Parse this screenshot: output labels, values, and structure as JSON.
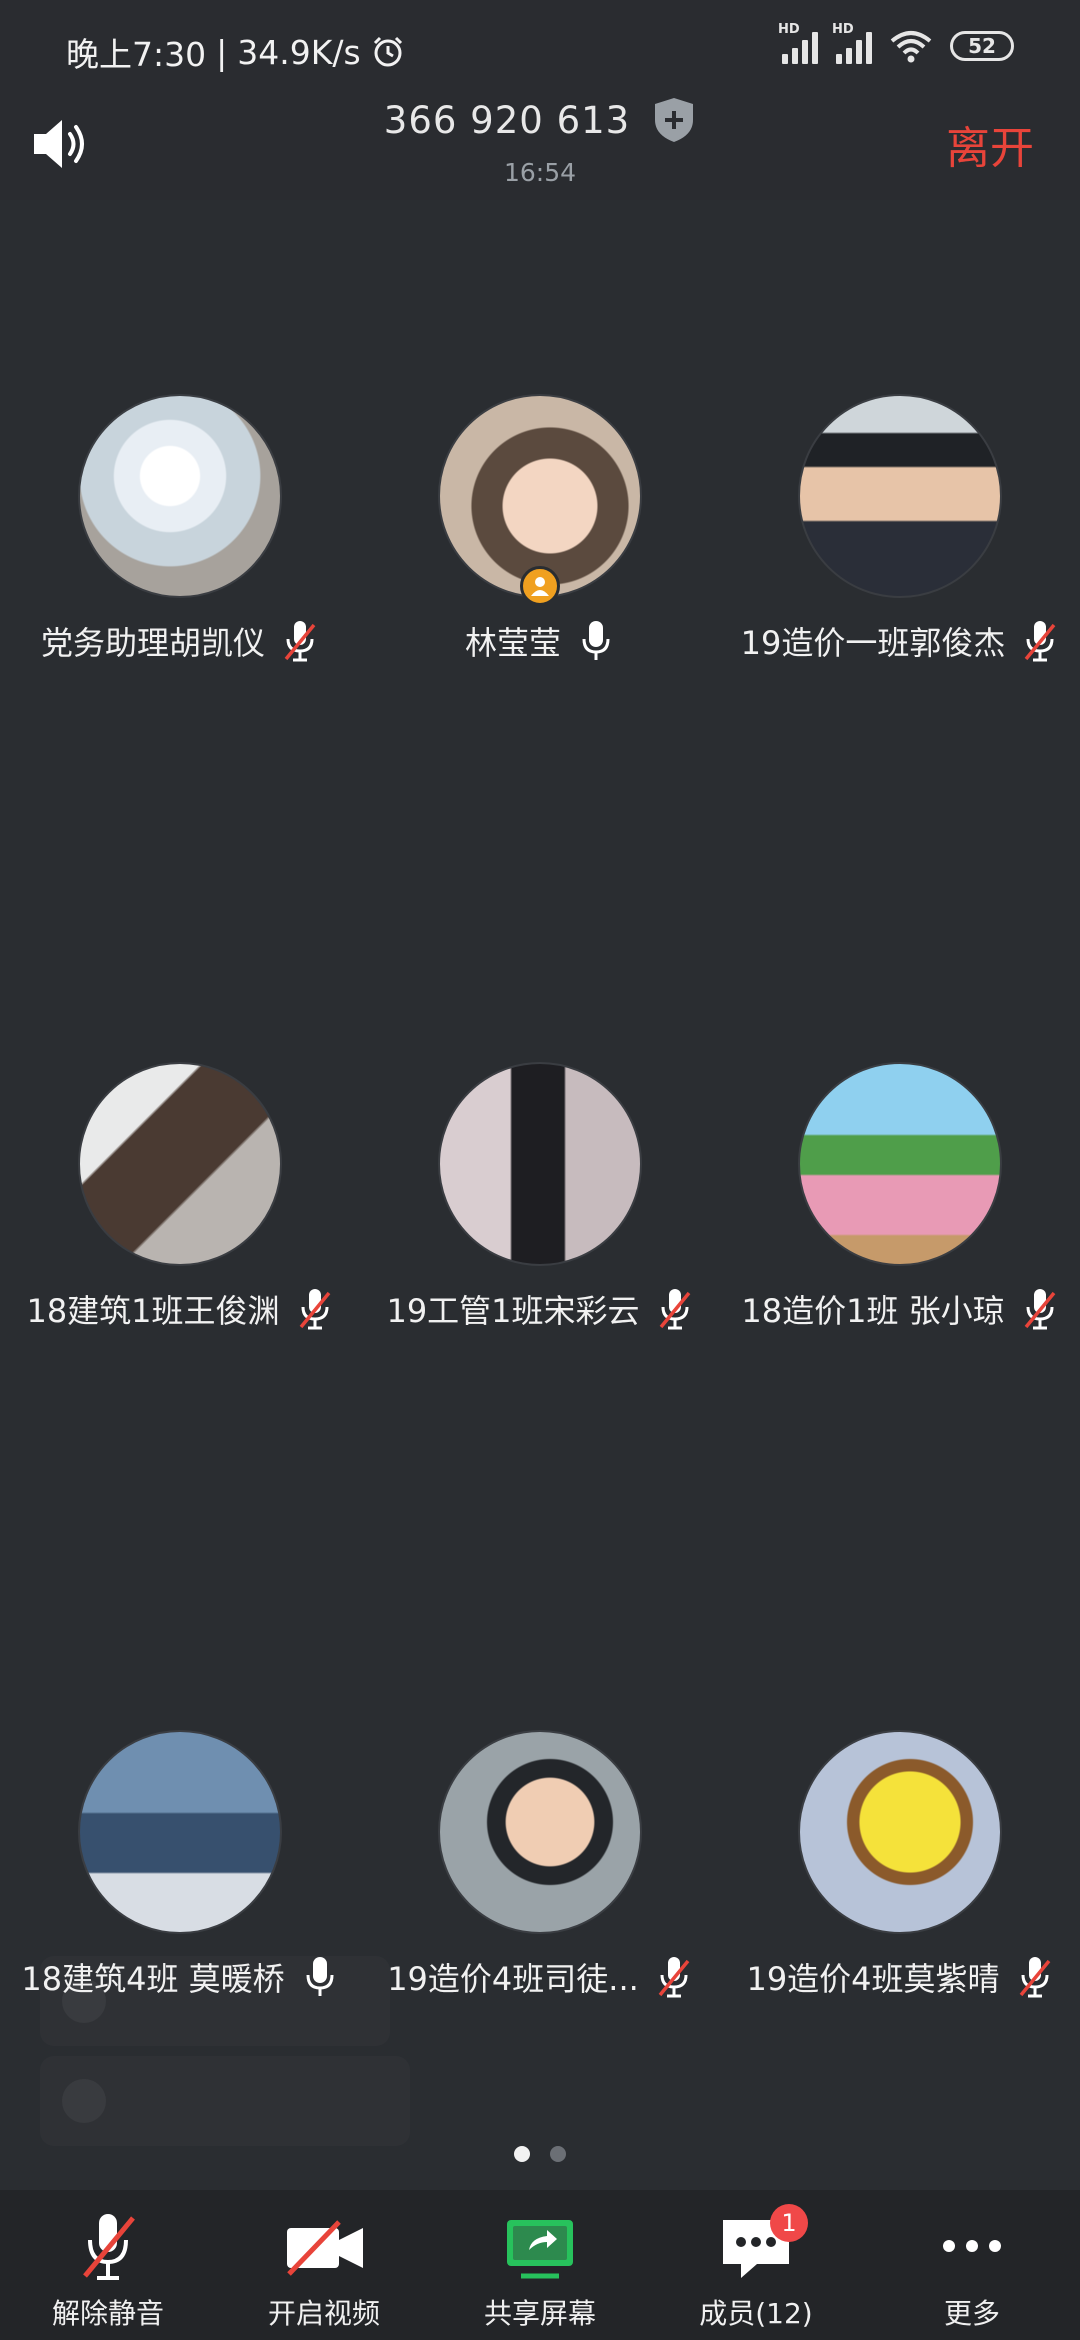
{
  "status_bar": {
    "time": "晚上7:30",
    "speed": "34.9K/s",
    "battery": "52",
    "icons": [
      "alarm-icon",
      "hd-signal-icon",
      "hd-signal-icon",
      "wifi-icon",
      "battery-icon"
    ]
  },
  "header": {
    "meeting_id": "366 920 613",
    "duration": "16:54",
    "leave_label": "离开"
  },
  "participants": [
    {
      "name": "党务助理胡凯仪",
      "mic": "muted",
      "host": false
    },
    {
      "name": "林莹莹",
      "mic": "on",
      "host": true
    },
    {
      "name": "19造价一班郭俊杰",
      "mic": "muted",
      "host": false
    },
    {
      "name": "18建筑1班王俊渊",
      "mic": "muted",
      "host": false
    },
    {
      "name": "19工管1班宋彩云",
      "mic": "muted",
      "host": false
    },
    {
      "name": "18造价1班  张小琼",
      "mic": "muted",
      "host": false
    },
    {
      "name": "18建筑4班 莫暖桥",
      "mic": "on",
      "host": false
    },
    {
      "name": "19造价4班司徒...",
      "mic": "muted",
      "host": false
    },
    {
      "name": "19造价4班莫紫晴",
      "mic": "muted",
      "host": false
    }
  ],
  "pagination": {
    "current": 1,
    "total": 2
  },
  "toolbar": {
    "unmute_label": "解除静音",
    "video_label": "开启视频",
    "share_label": "共享屏幕",
    "members_label": "成员(12)",
    "members_badge": "1",
    "more_label": "更多"
  },
  "colors": {
    "background": "#2a2d31",
    "leave": "#e8443a",
    "share_green": "#27c25c",
    "muted_red": "#e8443a",
    "host_badge": "#f0a020"
  }
}
